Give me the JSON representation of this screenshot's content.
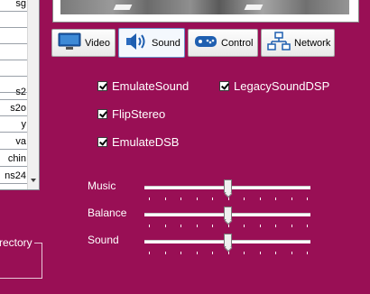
{
  "list": {
    "items": [
      "sg",
      "",
      "",
      "",
      "",
      "",
      "s2",
      "s2o",
      "y",
      "va",
      "chin",
      "ns24"
    ]
  },
  "directory_group": {
    "label": "rectory"
  },
  "tabs": [
    {
      "label": "Video",
      "icon": "monitor-icon"
    },
    {
      "label": "Sound",
      "icon": "speaker-icon",
      "active": true
    },
    {
      "label": "Control",
      "icon": "gamepad-icon"
    },
    {
      "label": "Network",
      "icon": "network-icon"
    }
  ],
  "options": {
    "emulate_sound": {
      "label": "EmulateSound",
      "checked": true
    },
    "legacy_sound_dsp": {
      "label": "LegacySoundDSP",
      "checked": true
    },
    "flip_stereo": {
      "label": "FlipStereo",
      "checked": true
    },
    "emulate_dsb": {
      "label": "EmulateDSB",
      "checked": true
    }
  },
  "sliders": {
    "music": {
      "label": "Music",
      "value": 0.5
    },
    "balance": {
      "label": "Balance",
      "value": 0.5
    },
    "sound": {
      "label": "Sound",
      "value": 0.5
    }
  },
  "colors": {
    "background": "#990f55",
    "tab_active_border": "#6a94c9"
  }
}
